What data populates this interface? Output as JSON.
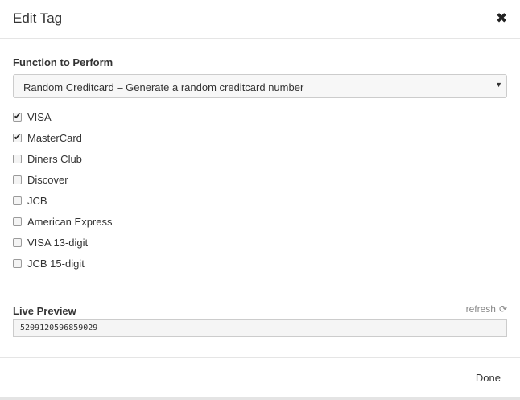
{
  "modal": {
    "title": "Edit Tag",
    "close_icon": "close-icon"
  },
  "function": {
    "label": "Function to Perform",
    "selected": "Random Creditcard – Generate a random creditcard number",
    "caret_icon": "caret-down-icon"
  },
  "card_types": [
    {
      "label": "VISA",
      "checked": true
    },
    {
      "label": "MasterCard",
      "checked": true
    },
    {
      "label": "Diners Club",
      "checked": false
    },
    {
      "label": "Discover",
      "checked": false
    },
    {
      "label": "JCB",
      "checked": false
    },
    {
      "label": "American Express",
      "checked": false
    },
    {
      "label": "VISA 13-digit",
      "checked": false
    },
    {
      "label": "JCB 15-digit",
      "checked": false
    }
  ],
  "preview": {
    "label": "Live Preview",
    "refresh_label": "refresh",
    "refresh_icon": "refresh-icon",
    "value": "5209120596859029"
  },
  "footer": {
    "done_label": "Done"
  }
}
